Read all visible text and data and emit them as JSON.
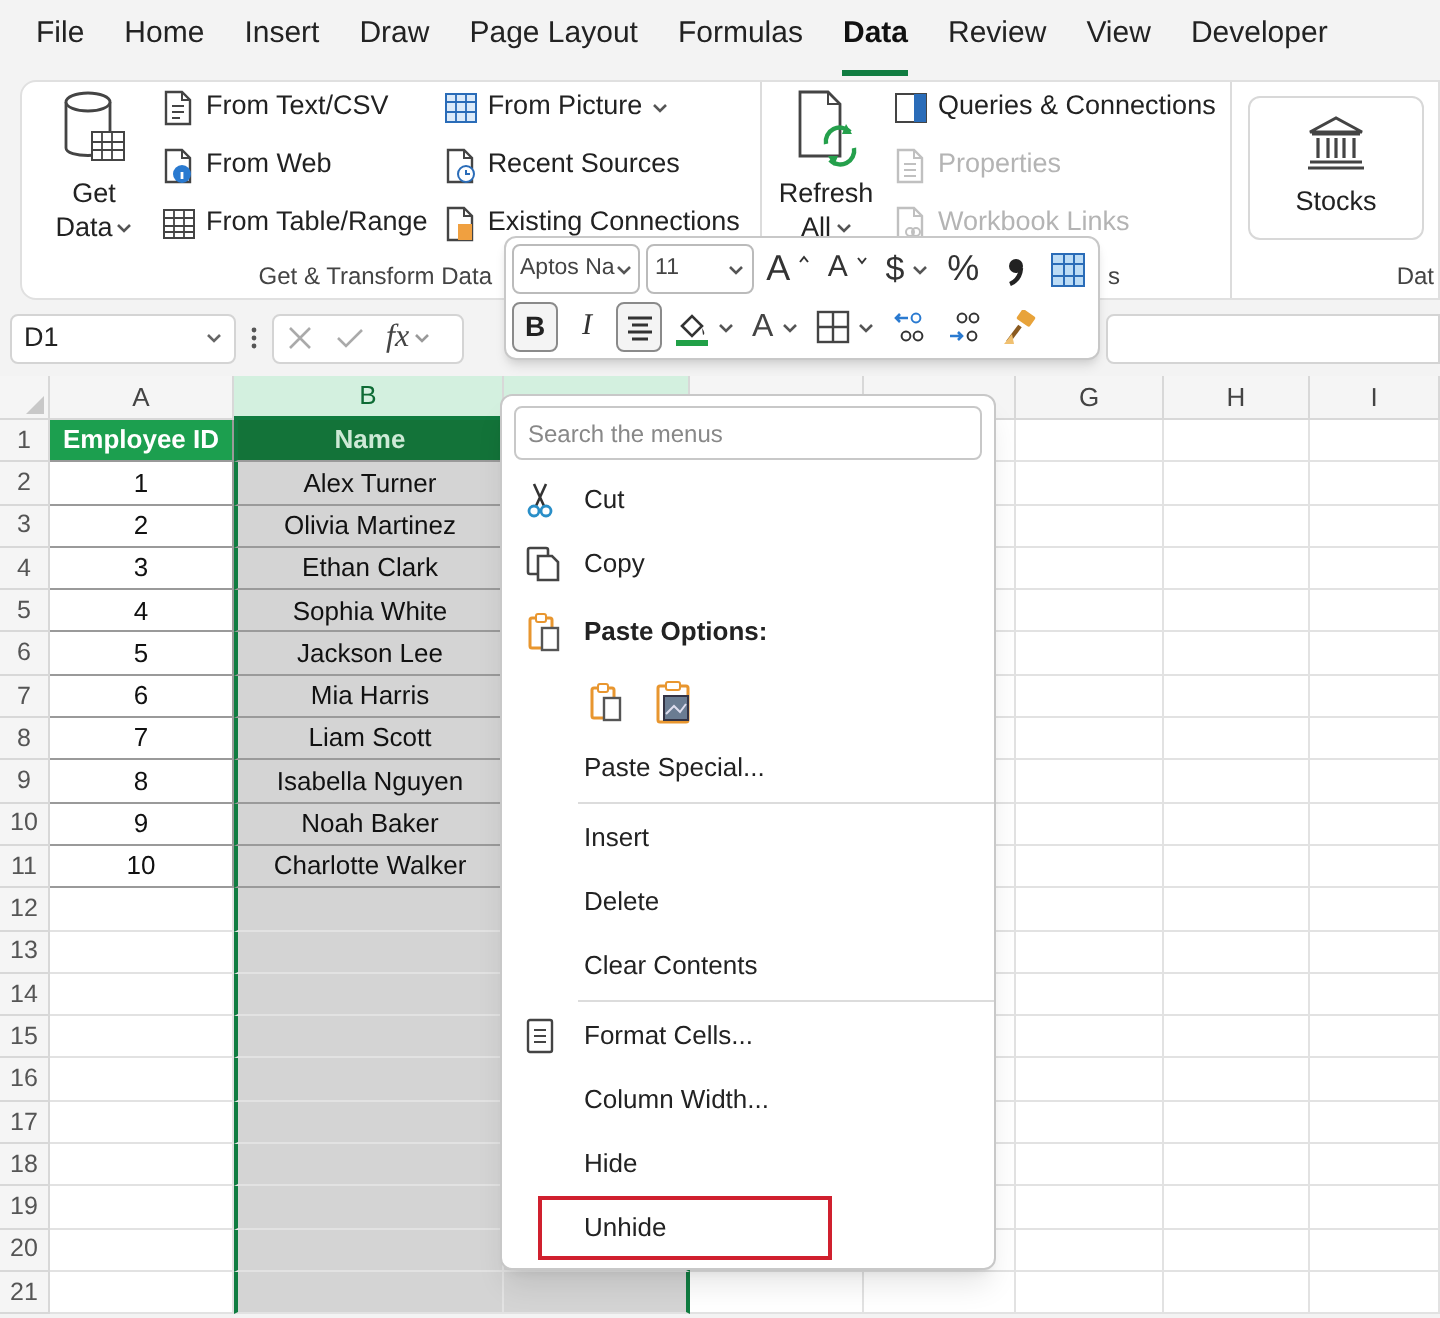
{
  "menu_tabs": [
    {
      "label": "File",
      "selected": false
    },
    {
      "label": "Home",
      "selected": false
    },
    {
      "label": "Insert",
      "selected": false
    },
    {
      "label": "Draw",
      "selected": false
    },
    {
      "label": "Page Layout",
      "selected": false
    },
    {
      "label": "Formulas",
      "selected": false
    },
    {
      "label": "Data",
      "selected": true
    },
    {
      "label": "Review",
      "selected": false
    },
    {
      "label": "View",
      "selected": false
    },
    {
      "label": "Developer",
      "selected": false
    }
  ],
  "ribbon_groups": [
    {
      "label": "Get & Transform Data",
      "big_button": {
        "kind": "database",
        "lines": [
          "Get",
          "Data"
        ],
        "dropdown": true
      },
      "columns": [
        [
          {
            "label": "From Text/CSV",
            "disabled": false,
            "dropdown": false
          },
          {
            "label": "From Web",
            "disabled": false,
            "dropdown": false
          },
          {
            "label": "From Table/Range",
            "disabled": false,
            "dropdown": false
          }
        ],
        [
          {
            "label": "From Picture",
            "disabled": false,
            "dropdown": true
          },
          {
            "label": "Recent Sources",
            "disabled": false,
            "dropdown": false
          },
          {
            "label": "Existing Connections",
            "disabled": false,
            "dropdown": false
          }
        ]
      ]
    },
    {
      "label": "s",
      "big_button": {
        "kind": "refresh",
        "lines": [
          "Refresh",
          "All"
        ],
        "dropdown": true
      },
      "columns": [
        [
          {
            "label": "Queries & Connections",
            "disabled": false,
            "dropdown": false
          },
          {
            "label": "Properties",
            "disabled": true,
            "dropdown": false
          },
          {
            "label": "Workbook Links",
            "disabled": true,
            "dropdown": false
          }
        ]
      ]
    },
    {
      "label": "Dat",
      "big_button": {
        "kind": "stocks",
        "lines": [
          "Stocks"
        ],
        "dropdown": false
      }
    }
  ],
  "formula_bar": {
    "name_box": "D1",
    "function_label": "fx"
  },
  "mini_toolbar": {
    "font_name": "Aptos Na",
    "font_size": "11",
    "rows": [
      [
        {
          "kind": "grow",
          "label": "A"
        },
        {
          "kind": "shrink",
          "label": "A"
        },
        {
          "kind": "currency",
          "label": "$",
          "dropdown": true
        },
        {
          "kind": "percent",
          "label": "%"
        },
        {
          "kind": "comma"
        },
        {
          "kind": "format-table"
        }
      ],
      [
        {
          "kind": "bold",
          "label": "B",
          "selected": true
        },
        {
          "kind": "italic",
          "label": "I",
          "selected": false
        },
        {
          "kind": "center",
          "selected": true
        },
        {
          "kind": "fill",
          "dropdown": true
        },
        {
          "kind": "font-color",
          "label": "A",
          "dropdown": true
        },
        {
          "kind": "borders",
          "dropdown": true
        },
        {
          "kind": "inc-decimal"
        },
        {
          "kind": "dec-decimal"
        },
        {
          "kind": "painter"
        }
      ]
    ]
  },
  "sheet": {
    "columns": [
      {
        "label": "A",
        "selected": false
      },
      {
        "label": "B",
        "selected": true
      },
      {
        "selected": true
      },
      {
        "selected": false
      },
      {
        "selected": false
      },
      {
        "label": "G",
        "selected": false
      },
      {
        "label": "H",
        "selected": false
      },
      {
        "label": "I",
        "selected": false
      }
    ],
    "row_numbers": [
      "1",
      "2",
      "3",
      "4",
      "5",
      "6",
      "7",
      "8",
      "9",
      "10",
      "11",
      "12",
      "13",
      "14",
      "15",
      "16",
      "17",
      "18",
      "19",
      "20",
      "21"
    ],
    "header_row": [
      "Employee ID",
      "Name"
    ],
    "rows": [
      [
        "1",
        "Alex Turner"
      ],
      [
        "2",
        "Olivia Martinez"
      ],
      [
        "3",
        "Ethan Clark"
      ],
      [
        "4",
        "Sophia White"
      ],
      [
        "5",
        "Jackson Lee"
      ],
      [
        "6",
        "Mia Harris"
      ],
      [
        "7",
        "Liam Scott"
      ],
      [
        "8",
        "Isabella Nguyen"
      ],
      [
        "9",
        "Noah Baker"
      ],
      [
        "10",
        "Charlotte Walker"
      ]
    ]
  },
  "context_menu": {
    "search_placeholder": "Search the menus",
    "items": [
      {
        "kind": "item",
        "label": "Cut",
        "highlighted": false
      },
      {
        "kind": "item",
        "label": "Copy",
        "highlighted": false
      },
      {
        "kind": "heading",
        "label": "Paste Options:"
      },
      {
        "kind": "paste-icons"
      },
      {
        "kind": "item",
        "label": "Paste Special...",
        "highlighted": false
      },
      {
        "kind": "separator"
      },
      {
        "kind": "item",
        "label": "Insert",
        "highlighted": false
      },
      {
        "kind": "item",
        "label": "Delete",
        "highlighted": false
      },
      {
        "kind": "item",
        "label": "Clear Contents",
        "highlighted": false
      },
      {
        "kind": "separator"
      },
      {
        "kind": "item",
        "label": "Format Cells...",
        "highlighted": false
      },
      {
        "kind": "item",
        "label": "Column Width...",
        "highlighted": false
      },
      {
        "kind": "item",
        "label": "Hide",
        "highlighted": false
      },
      {
        "kind": "item",
        "label": "Unhide",
        "highlighted": true
      }
    ]
  }
}
